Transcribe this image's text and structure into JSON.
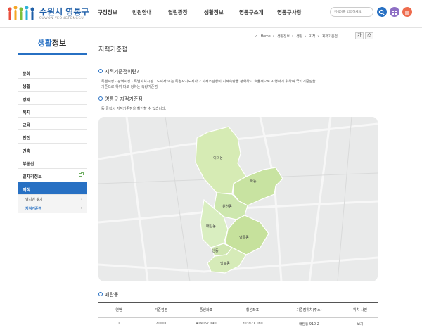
{
  "header": {
    "logo_text": "수원시 영통구",
    "logo_sub": "SUWON YEONGTONGGU",
    "nav": [
      "구정정보",
      "민원안내",
      "열린광장",
      "생활정보",
      "영통구소개",
      "영통구사랑"
    ],
    "search_placeholder": "검색어를 입력하세요",
    "colors": {
      "brand": "#1f5fa8",
      "accent": "#2770c3"
    }
  },
  "sidebar": {
    "title_highlight": "생활",
    "title_rest": "정보",
    "items": [
      {
        "label": "문화"
      },
      {
        "label": "생활"
      },
      {
        "label": "경제"
      },
      {
        "label": "복지"
      },
      {
        "label": "교육"
      },
      {
        "label": "안전"
      },
      {
        "label": "건축"
      },
      {
        "label": "부동산"
      },
      {
        "label": "일자리정보",
        "icon": "external-link-icon"
      },
      {
        "label": "지적",
        "active": true
      }
    ],
    "subitems": [
      {
        "label": "엥지번 찾기"
      },
      {
        "label": "지적기준점",
        "on": true
      }
    ]
  },
  "breadcrumb": [
    "Home",
    "생활정보",
    "생활",
    "지적",
    "지적기준점"
  ],
  "page_title": "지적기준점",
  "section1": {
    "heading": "지적기준점이란?",
    "lines": [
      "특별시장 · 광역시장 · 특별자치시장 · 도지사 또는 특별자치도지사나 지적소관청이 지적측량을 정확하고 효율적으로 시행하기 위하여 국가기준점을",
      "기준으로 하여 따로 정하는 측량기준점"
    ]
  },
  "section2": {
    "heading": "영통구 지적기준점",
    "line": "동 클릭시 지적기준점을 확인할 수 있습니다."
  },
  "map": {
    "districts": [
      "이의동",
      "하동",
      "원천동",
      "매탄동",
      "영통동",
      "산동",
      "망포동"
    ]
  },
  "section3": {
    "heading": "매탄동"
  },
  "table": {
    "headers": [
      "연번",
      "기준점명",
      "종선좌표",
      "횡선좌표",
      "기준점위치(주소)",
      "위치 사진"
    ],
    "rows": [
      [
        "1",
        "71001",
        "419062.090",
        "203927.160",
        "매탄동 910-2",
        "보기"
      ]
    ]
  }
}
